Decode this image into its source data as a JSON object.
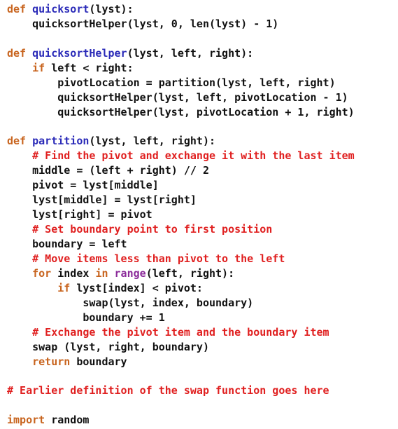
{
  "colors": {
    "keyword": "#c8641e",
    "function_name": "#2a2ab8",
    "builtin": "#8b2b9a",
    "comment": "#e02020",
    "text": "#111111",
    "background": "#ffffff"
  },
  "lines": [
    [
      {
        "t": "kw",
        "s": "def"
      },
      {
        "t": "tx",
        "s": " "
      },
      {
        "t": "fn",
        "s": "quicksort"
      },
      {
        "t": "tx",
        "s": "(lyst):"
      }
    ],
    [
      {
        "t": "tx",
        "s": "    quicksortHelper(lyst, 0, len(lyst) - 1)"
      }
    ],
    [],
    [
      {
        "t": "kw",
        "s": "def"
      },
      {
        "t": "tx",
        "s": " "
      },
      {
        "t": "fn",
        "s": "quicksortHelper"
      },
      {
        "t": "tx",
        "s": "(lyst, left, right):"
      }
    ],
    [
      {
        "t": "tx",
        "s": "    "
      },
      {
        "t": "kw",
        "s": "if"
      },
      {
        "t": "tx",
        "s": " left < right:"
      }
    ],
    [
      {
        "t": "tx",
        "s": "        pivotLocation = partition(lyst, left, right)"
      }
    ],
    [
      {
        "t": "tx",
        "s": "        quicksortHelper(lyst, left, pivotLocation - 1)"
      }
    ],
    [
      {
        "t": "tx",
        "s": "        quicksortHelper(lyst, pivotLocation + 1, right)"
      }
    ],
    [],
    [
      {
        "t": "kw",
        "s": "def"
      },
      {
        "t": "tx",
        "s": " "
      },
      {
        "t": "fn",
        "s": "partition"
      },
      {
        "t": "tx",
        "s": "(lyst, left, right):"
      }
    ],
    [
      {
        "t": "tx",
        "s": "    "
      },
      {
        "t": "cm",
        "s": "# Find the pivot and exchange it with the last item"
      }
    ],
    [
      {
        "t": "tx",
        "s": "    middle = (left + right) // 2"
      }
    ],
    [
      {
        "t": "tx",
        "s": "    pivot = lyst[middle]"
      }
    ],
    [
      {
        "t": "tx",
        "s": "    lyst[middle] = lyst[right]"
      }
    ],
    [
      {
        "t": "tx",
        "s": "    lyst[right] = pivot"
      }
    ],
    [
      {
        "t": "tx",
        "s": "    "
      },
      {
        "t": "cm",
        "s": "# Set boundary point to first position"
      }
    ],
    [
      {
        "t": "tx",
        "s": "    boundary = left"
      }
    ],
    [
      {
        "t": "tx",
        "s": "    "
      },
      {
        "t": "cm",
        "s": "# Move items less than pivot to the left"
      }
    ],
    [
      {
        "t": "tx",
        "s": "    "
      },
      {
        "t": "kw",
        "s": "for"
      },
      {
        "t": "tx",
        "s": " index "
      },
      {
        "t": "kw",
        "s": "in"
      },
      {
        "t": "tx",
        "s": " "
      },
      {
        "t": "bi",
        "s": "range"
      },
      {
        "t": "tx",
        "s": "(left, right):"
      }
    ],
    [
      {
        "t": "tx",
        "s": "        "
      },
      {
        "t": "kw",
        "s": "if"
      },
      {
        "t": "tx",
        "s": " lyst[index] < pivot:"
      }
    ],
    [
      {
        "t": "tx",
        "s": "            swap(lyst, index, boundary)"
      }
    ],
    [
      {
        "t": "tx",
        "s": "            boundary += 1"
      }
    ],
    [
      {
        "t": "tx",
        "s": "    "
      },
      {
        "t": "cm",
        "s": "# Exchange the pivot item and the boundary item"
      }
    ],
    [
      {
        "t": "tx",
        "s": "    swap (lyst, right, boundary)"
      }
    ],
    [
      {
        "t": "tx",
        "s": "    "
      },
      {
        "t": "kw",
        "s": "return"
      },
      {
        "t": "tx",
        "s": " boundary"
      }
    ],
    [],
    [
      {
        "t": "cm",
        "s": "# Earlier definition of the swap function goes here"
      }
    ],
    [],
    [
      {
        "t": "kw",
        "s": "import"
      },
      {
        "t": "tx",
        "s": " random"
      }
    ]
  ]
}
